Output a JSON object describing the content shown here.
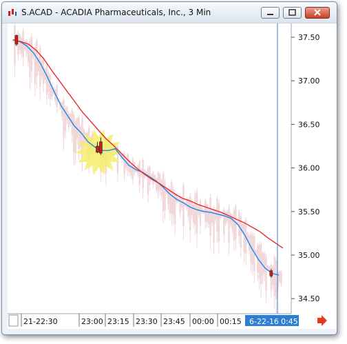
{
  "window": {
    "title": "S.ACAD - ACADIA Pharmaceuticals, Inc., 3 Min"
  },
  "colors": {
    "fast_ma": "#1e86e8",
    "slow_ma": "#e8262c",
    "cursor_line": "#2d7fd6",
    "down_candle": "#c81e1e",
    "faded_candle": "#f0d6d8",
    "selection": "#2d7fd6"
  },
  "chart_data": {
    "type": "line",
    "x_ticks": [
      "21-22:30",
      "23:00",
      "23:15",
      "23:30",
      "23:45",
      "00:00",
      "00:15"
    ],
    "x_selected": {
      "date": "6-22-16",
      "time": "0:45"
    },
    "y_ticks": [
      "37.50",
      "37.00",
      "36.50",
      "36.00",
      "35.50",
      "35.00",
      "34.50"
    ],
    "ylim": [
      34.34,
      37.7
    ],
    "x_start_label_time": "22:30",
    "series": [
      {
        "color_key": "fast_ma",
        "values": [
          37.47,
          37.45,
          37.4,
          37.32,
          37.2,
          37.05,
          36.88,
          36.72,
          36.6,
          36.48,
          36.4,
          36.3,
          36.24,
          36.2,
          36.2,
          36.22,
          36.12,
          36.03,
          35.98,
          35.95,
          35.9,
          35.85,
          35.78,
          35.7,
          35.64,
          35.6,
          35.55,
          35.52,
          35.5,
          35.49,
          35.47,
          35.45,
          35.42,
          35.35,
          35.23,
          35.08,
          34.95,
          34.85,
          34.79,
          34.77
        ]
      },
      {
        "color_key": "slow_ma",
        "values": [
          37.47,
          37.45,
          37.42,
          37.35,
          37.25,
          37.12,
          37.0,
          36.88,
          36.76,
          36.64,
          36.54,
          36.44,
          36.34,
          36.26,
          36.17,
          36.08,
          36.0,
          35.93,
          35.87,
          35.82,
          35.76,
          35.7,
          35.65,
          35.62,
          35.58,
          35.55,
          35.52,
          35.49,
          35.45,
          35.41,
          35.37,
          35.32,
          35.27,
          35.2,
          35.14,
          35.08
        ]
      }
    ],
    "highlighted_candles": [
      {
        "time_index": 2,
        "open": 37.52,
        "close": 37.42,
        "high": 37.53,
        "low": 37.4
      },
      {
        "time_index": 50,
        "open": 36.25,
        "close": 36.18,
        "high": 36.3,
        "low": 36.17
      },
      {
        "time_index": 52,
        "open": 36.3,
        "close": 36.17,
        "high": 36.35,
        "low": 36.15
      },
      {
        "time_index": 153,
        "open": 34.82,
        "close": 34.76,
        "high": 34.84,
        "low": 34.74
      }
    ],
    "cursor_time_index": 160
  }
}
